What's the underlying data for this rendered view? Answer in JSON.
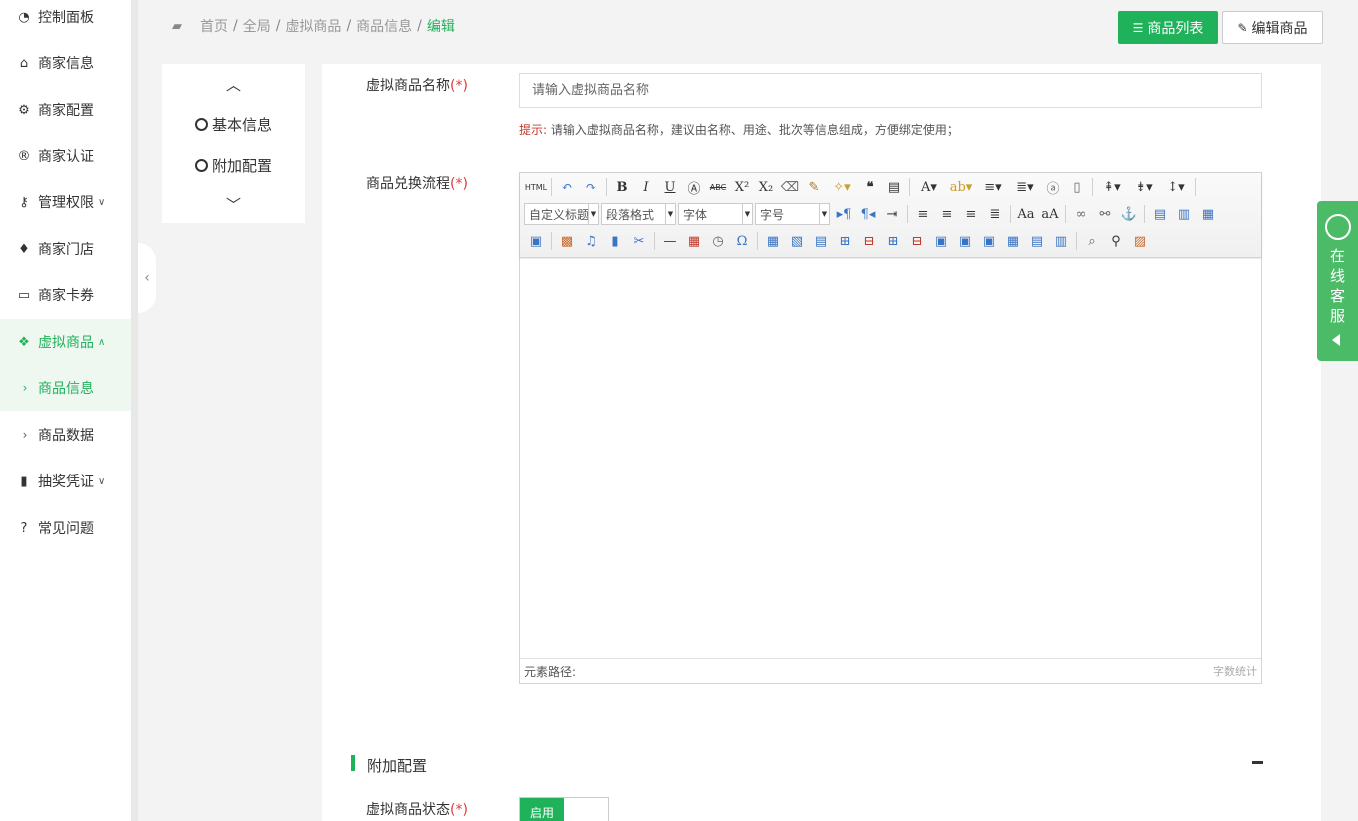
{
  "sidebar": {
    "items": [
      {
        "label": "控制面板",
        "icon": "dashboard-icon"
      },
      {
        "label": "商家信息",
        "icon": "home-icon"
      },
      {
        "label": "商家配置",
        "icon": "gears-icon"
      },
      {
        "label": "商家认证",
        "icon": "registered-icon"
      },
      {
        "label": "管理权限",
        "icon": "key-icon"
      },
      {
        "label": "商家门店",
        "icon": "map-marker-icon"
      },
      {
        "label": "商家卡券",
        "icon": "credit-card-icon"
      },
      {
        "label": "虚拟商品",
        "icon": "dropbox-icon"
      },
      {
        "label": "商品信息",
        "icon": "chevron-right-icon"
      },
      {
        "label": "商品数据",
        "icon": "chevron-right-icon"
      },
      {
        "label": "抽奖凭证",
        "icon": "bookmark-icon"
      },
      {
        "label": "常见问题",
        "icon": "question-circle-icon"
      }
    ]
  },
  "breadcrumb": {
    "items": [
      "首页",
      "全局",
      "虚拟商品",
      "商品信息"
    ],
    "current": "编辑"
  },
  "header": {
    "list_button": "商品列表",
    "edit_button": "编辑商品"
  },
  "anchors": {
    "items": [
      "基本信息",
      "附加配置"
    ]
  },
  "form": {
    "name_label": "虚拟商品名称",
    "required_mark": "(*)",
    "name_placeholder": "请输入虚拟商品名称",
    "hint_tag": "提示:",
    "hint_text": "请输入虚拟商品名称，建议由名称、用途、批次等信息组成，方便绑定使用；",
    "flow_label": "商品兑换流程",
    "status_label": "虚拟商品状态",
    "status_value": "启用"
  },
  "editor": {
    "html_label": "HTML",
    "selects": [
      "自定义标题",
      "段落格式",
      "字体",
      "字号"
    ],
    "path_label": "元素路径:",
    "count_label": "字数统计"
  },
  "section": {
    "title": "附加配置"
  },
  "service": {
    "label_chars": [
      "在",
      "线",
      "客",
      "服"
    ]
  },
  "colors": {
    "accent": "#1fb25a",
    "service": "#4cbb67",
    "required": "#e03a3a"
  }
}
